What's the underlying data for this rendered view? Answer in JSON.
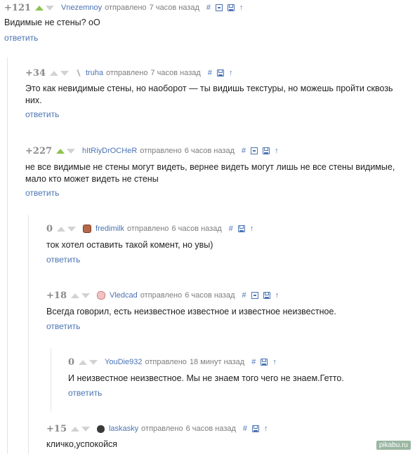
{
  "actions": {
    "sent_label": "отправлено",
    "reply_label": "ответить"
  },
  "icons": [
    "hash-icon",
    "collapse-icon",
    "save-icon",
    "parent-arrow-icon"
  ],
  "colors": {
    "link": "#4a73b3",
    "upvote_active": "#8bc34a",
    "vote_inactive": "#d2d2d2",
    "rating": "#8a8a8a"
  },
  "comments": [
    {
      "rating": "+121",
      "upvoted": true,
      "username": "Vnezemnoy",
      "time": "7 часов назад",
      "text": "Видимые не стены? оО"
    },
    {
      "rating": "+34",
      "upvoted": false,
      "username": "truha",
      "time": "7 часов назад",
      "text": "Это как невидимые стены, но наоборот — ты видишь текстуры, но можешь пройти сквозь них."
    },
    {
      "rating": "+227",
      "upvoted": true,
      "username": "hItRiyDrOCHeR",
      "time": "6 часов назад",
      "text": "не все видимые не стены могут видеть, вернее видеть могут лишь не все стены видимые, мало кто может видеть не стены"
    },
    {
      "rating": "0",
      "upvoted": false,
      "username": "fredimilk",
      "time": "6 часов назад",
      "text": "ток хотел оставить такой комент, но увы)"
    },
    {
      "rating": "+18",
      "upvoted": false,
      "username": "Vledcad",
      "time": "6 часов назад",
      "text": "Всегда говорил, есть неизвестное известное и известное неизвестное."
    },
    {
      "rating": "0",
      "upvoted": false,
      "username": "YouDie932",
      "time": "18 минут назад",
      "text": "И неизвестное неизвестное. Мы не знаем того чего не знаем.Гетто."
    },
    {
      "rating": "+15",
      "upvoted": false,
      "username": "laskasky",
      "time": "6 часов назад",
      "text": "кличко,успокойся"
    }
  ],
  "watermark": "pikabu.ru"
}
